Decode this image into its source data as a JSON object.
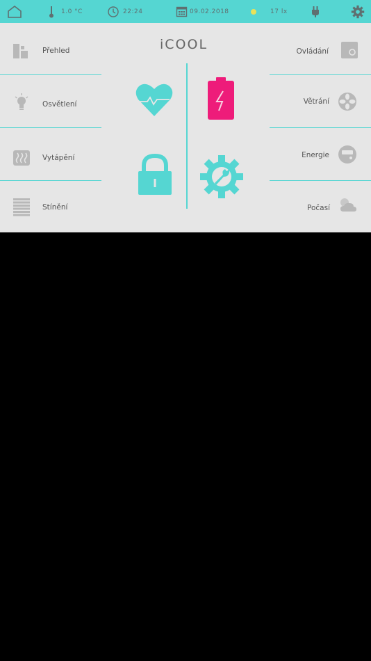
{
  "status": {
    "temperature": "1.0  °C",
    "time": "22:24",
    "date": "09.02.2018",
    "light": "17  lx"
  },
  "logo": "iCOOL",
  "left_menu": [
    "Přehled",
    "Osvětlení",
    "Vytápění",
    "Stínění"
  ],
  "right_menu": [
    "Ovládání",
    "Větrání",
    "Energie",
    "Počasí"
  ],
  "colors": {
    "accent": "#55d6d2",
    "battery": "#ee1c7a",
    "sun": "#e8e25a",
    "icon_gray": "#b8b8b8"
  },
  "icons": {
    "status": [
      "home-icon",
      "thermometer-icon",
      "clock-icon",
      "calendar-icon",
      "sun-icon",
      "plug-icon",
      "gear-icon"
    ],
    "center": [
      "heart-pulse-icon",
      "battery-charge-icon",
      "lock-icon",
      "gear-wrench-icon"
    ]
  }
}
